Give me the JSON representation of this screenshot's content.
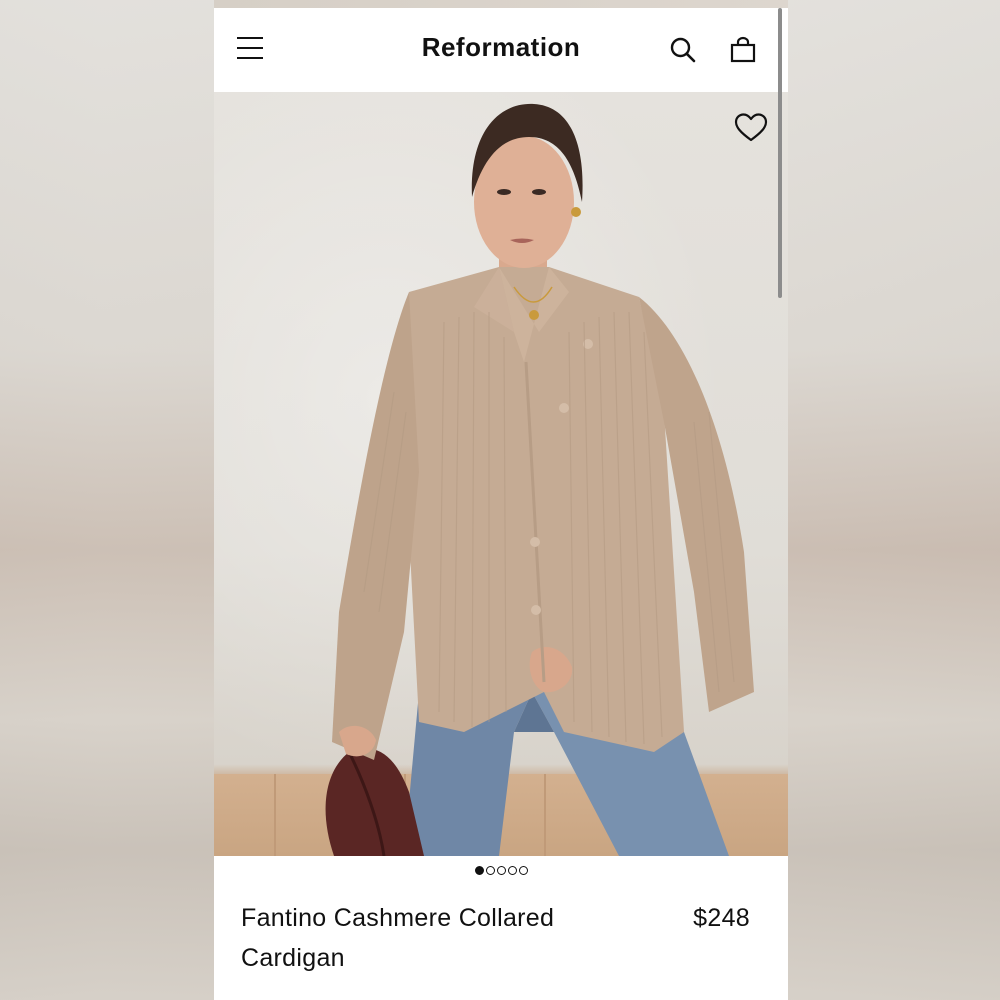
{
  "header": {
    "brand": "Reformation",
    "menu_icon": "hamburger-menu-icon",
    "search_icon": "search-icon",
    "bag_icon": "shopping-bag-icon"
  },
  "product": {
    "title": "Fantino Cashmere Collared Cardigan",
    "price": "$248",
    "favorite_icon": "heart-outline-icon",
    "image_carousel": {
      "total": 5,
      "active": 1
    }
  },
  "colors": {
    "text": "#111111",
    "background": "#ffffff",
    "sweater": "#c7ae97",
    "denim": "#6b84a3"
  }
}
